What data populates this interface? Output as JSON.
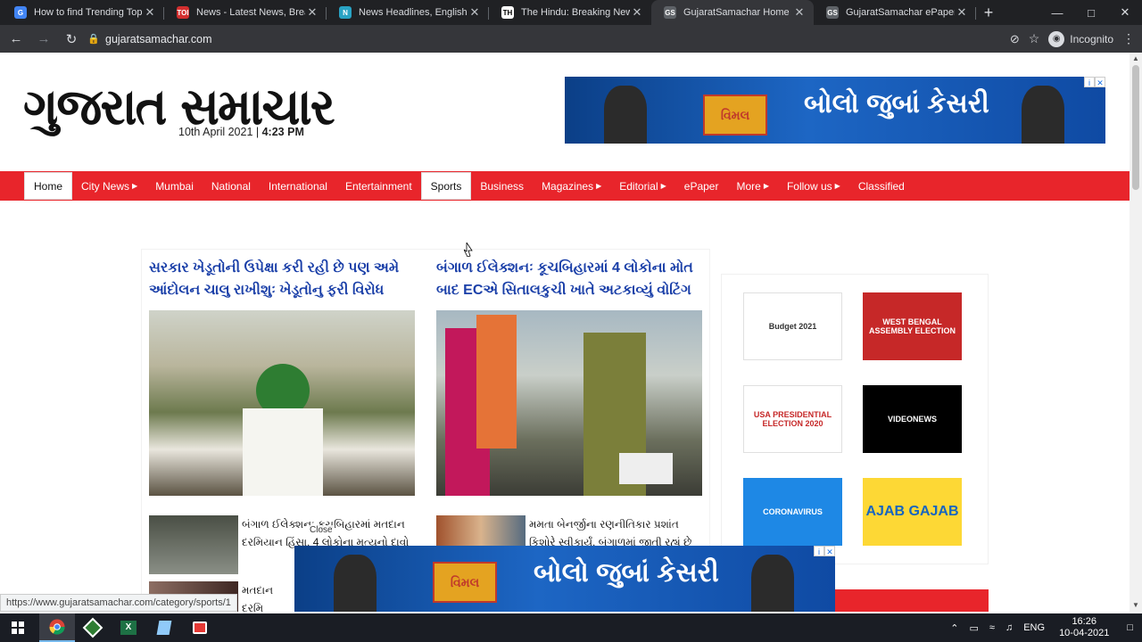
{
  "browser": {
    "tabs": [
      {
        "title": "How to find Trending Topics",
        "icon": "google-icon",
        "color": "#4285f4",
        "glyph": "G"
      },
      {
        "title": "News - Latest News, Breaking",
        "icon": "toi-icon",
        "color": "#d32f2f",
        "glyph": "TOI"
      },
      {
        "title": "News Headlines, English New",
        "icon": "news-icon",
        "color": "#29a3c4",
        "glyph": "N"
      },
      {
        "title": "The Hindu: Breaking News, In",
        "icon": "hindu-icon",
        "color": "#ffffff",
        "glyph": "TH"
      },
      {
        "title": "GujaratSamachar Home Guja",
        "icon": "gs-icon",
        "color": "#5f6368",
        "glyph": "GS"
      },
      {
        "title": "GujaratSamachar ePaper",
        "icon": "gs-icon",
        "color": "#5f6368",
        "glyph": "GS"
      }
    ],
    "active_tab": 4,
    "url": "gujaratsamachar.com",
    "profile_label": "Incognito",
    "status_url": "https://www.gujaratsamachar.com/category/sports/1"
  },
  "site": {
    "logo_text": "ગુજરાત સમાચાર",
    "date": "10th April 2021 |",
    "time": "4:23 PM"
  },
  "ad": {
    "brand": "વિમલ",
    "slogan": "બોલો જુબાં કેસરી",
    "close_label": "Close"
  },
  "nav": {
    "items": [
      {
        "label": "Home",
        "has_menu": false
      },
      {
        "label": "City News",
        "has_menu": true
      },
      {
        "label": "Mumbai",
        "has_menu": false
      },
      {
        "label": "National",
        "has_menu": false
      },
      {
        "label": "International",
        "has_menu": false
      },
      {
        "label": "Entertainment",
        "has_menu": false
      },
      {
        "label": "Sports",
        "has_menu": false
      },
      {
        "label": "Business",
        "has_menu": false
      },
      {
        "label": "Magazines",
        "has_menu": true
      },
      {
        "label": "Editorial",
        "has_menu": true
      },
      {
        "label": "ePaper",
        "has_menu": false
      },
      {
        "label": "More",
        "has_menu": true
      },
      {
        "label": "Follow us",
        "has_menu": true
      },
      {
        "label": "Classified",
        "has_menu": false
      }
    ],
    "selected": [
      "Home",
      "Sports"
    ]
  },
  "articles": {
    "lead_left": {
      "headline": "સરકાર ખેડૂતોની ઉપેક્ષા કરી રહી છે પણ અમે આંદોલન ચાલુ રાખીશુઃ ખેડૂતોનુ ફરી વિરોધ"
    },
    "lead_right": {
      "headline": "બંગાળ ઈલેક્શનઃ કૂચબિહારમાં 4 લોકોના મોત બાદ ECએ સિતાલકુચી ખાતે અટકાવ્યું વોટિંગ"
    },
    "small": [
      {
        "text": "બંગાળ ઈલેક્શનઃ કૂચબિહારમાં મતદાન દરમિયાન હિંસા, 4 લોકોના મૃત્યુનો દાવો"
      },
      {
        "text": "મમતા બેનર્જીના રણનીતિકાર પ્રશાંત કિશોરે સ્વીકાર્યું, બંગાળમાં જીતી રહ્યું છે"
      },
      {
        "text": "મતદાન દરમિ ભાજપના ઉમ"
      }
    ]
  },
  "sidebar": {
    "tiles": [
      {
        "label": "Budget 2021",
        "bg": "#ffffff"
      },
      {
        "label": "WEST BENGAL ASSEMBLY ELECTION",
        "bg": "#c62828"
      },
      {
        "label": "USA PRESIDENTIAL ELECTION 2020",
        "bg": "#ffffff"
      },
      {
        "label": "VIDEONEWS",
        "bg": "#000000"
      },
      {
        "label": "CORONAVIRUS",
        "bg": "#1e88e5"
      },
      {
        "label": "AJAB GAJAB",
        "bg": "#fdd835"
      }
    ]
  },
  "taskbar": {
    "lang": "ENG",
    "time": "16:26",
    "date": "10-04-2021"
  }
}
